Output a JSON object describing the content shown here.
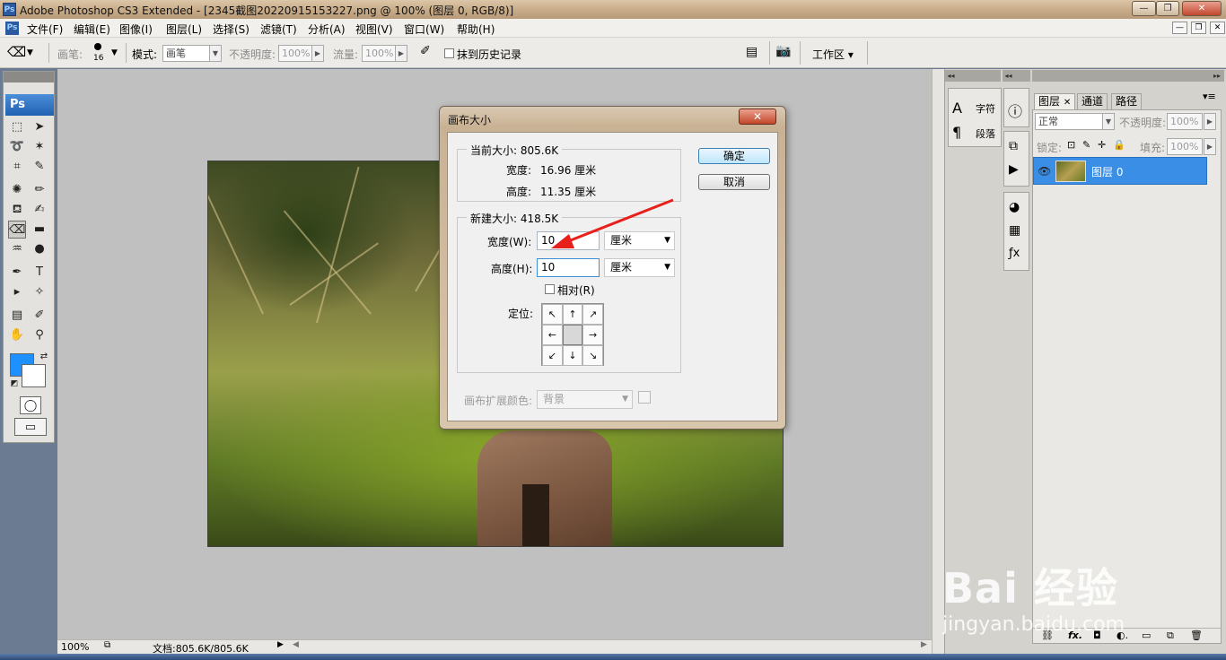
{
  "window": {
    "title": "Adobe Photoshop CS3 Extended - [2345截图20220915153227.png @ 100% (图层 0, RGB/8)]",
    "app_icon": "Ps",
    "controls": {
      "minimize": "—",
      "maximize": "❐",
      "close": "✕"
    }
  },
  "menubar": {
    "items": [
      "文件(F)",
      "编辑(E)",
      "图像(I)",
      "图层(L)",
      "选择(S)",
      "滤镜(T)",
      "分析(A)",
      "视图(V)",
      "窗口(W)",
      "帮助(H)"
    ]
  },
  "options": {
    "brush_label": "画笔:",
    "brush_size": "16",
    "mode_label": "模式:",
    "mode_value": "画笔",
    "opacity_label": "不透明度:",
    "opacity_value": "100%",
    "flow_label": "流量:",
    "flow_value": "100%",
    "erase_history_label": "抹到历史记录",
    "workspace_label": "工作区 ▾"
  },
  "toolbox": {
    "logo": "Ps"
  },
  "dialog": {
    "title": "画布大小",
    "close": "✕",
    "current_size": {
      "legend": "当前大小: 805.6K",
      "width_label": "宽度:",
      "width_value": "16.96 厘米",
      "height_label": "高度:",
      "height_value": "11.35 厘米"
    },
    "new_size": {
      "legend": "新建大小: 418.5K",
      "width_label": "宽度(W):",
      "width_value": "10",
      "width_unit": "厘米",
      "height_label": "高度(H):",
      "height_value": "10",
      "height_unit": "厘米",
      "relative_label": "相对(R)",
      "anchor_label": "定位:"
    },
    "ok": "确定",
    "cancel": "取消",
    "ext_color_label": "画布扩展颜色:",
    "ext_color_value": "背景"
  },
  "panels": {
    "char_tab": "字符",
    "para_tab": "段落",
    "tabs": [
      "图层",
      "通道",
      "路径"
    ],
    "blend_mode": "正常",
    "opacity_label": "不透明度:",
    "opacity_value": "100%",
    "lock_label": "锁定:",
    "fill_label": "填充:",
    "fill_value": "100%",
    "layer_name": "图层 0"
  },
  "status": {
    "zoom": "100%",
    "doc_info": "文档:805.6K/805.6K"
  },
  "watermark": {
    "main": "Bai 经验",
    "sub": "jingyan.baidu.com"
  },
  "colors": {
    "foreground": "#1e90ff",
    "background": "#ffffff",
    "selection": "#3a8ee6",
    "annotation_arrow": "#e8201c"
  }
}
